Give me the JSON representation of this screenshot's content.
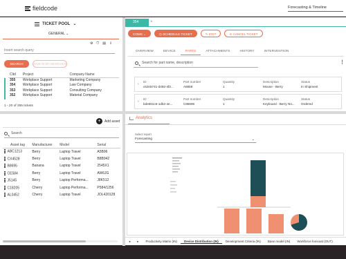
{
  "app": {
    "brand": "fieldcode",
    "view_selector": "Forecasting & Timeline"
  },
  "ticket_pool": {
    "title": "TICKET POOL",
    "subtitle": "GENERAL",
    "search_placeholder": "Insert search query",
    "search_btn": "SEARCH",
    "save_btn": "SAVE IN MY SEARCHES",
    "columns": [
      "Cltd",
      "Project",
      "Company Name"
    ],
    "rows": [
      [
        "355",
        "Workplace Support",
        "Marketing Company"
      ],
      [
        "354",
        "Workplace Support",
        "Law Company"
      ],
      [
        "353",
        "Workplace Support",
        "Consulting Company"
      ],
      [
        "352",
        "Workplace Support",
        "Material Company"
      ]
    ],
    "count": "1 - 20 of 355 tickets"
  },
  "assets": {
    "add_label": "Add asset",
    "search_placeholder": "Search",
    "columns": [
      "Asset tag",
      "Manufacturer",
      "Model",
      "Serial"
    ],
    "rows": [
      [
        "ABC1213",
        "Berry",
        "Laptop Travel",
        "A5B96"
      ],
      [
        "CX4528",
        "Berry",
        "Laptop Travel",
        "B8B942"
      ],
      [
        "B8695",
        "Banana",
        "Laptop Travel",
        "2545X1"
      ],
      [
        "CE584",
        "Berry",
        "Laptop Travel",
        "AW6JG"
      ],
      [
        "J5145",
        "Berry",
        "Laptop Performa...",
        "J8K512"
      ],
      [
        "C18205",
        "Cherry",
        "Laptop Performa...",
        "P584/1256"
      ],
      [
        "AL0452",
        "Cherry",
        "Laptop Travel",
        "JOL420128"
      ]
    ]
  },
  "ticket": {
    "id_tab": "354",
    "actions": [
      "COMS",
      "SCHEDULE TICKET",
      "EDIT",
      "CANCEL TICKET"
    ],
    "tabs": [
      "OVERVIEW",
      "DEVICE",
      "PARTS",
      "ATTACHMENTS",
      "HISTORY",
      "INTERVENTION"
    ],
    "active_tab": "PARTS",
    "parts_search_placeholder": "Search for part name, description",
    "parts_labels": [
      "ID",
      "Part number",
      "Quantity",
      "Description",
      "Status"
    ],
    "parts": [
      {
        "id": "c62e5741-d492-4f3...",
        "part_number": "A8659",
        "quantity": "1",
        "description": "Mouse - Berry",
        "status": "In Shipment"
      },
      {
        "id": "bde661c6-1db2-4e...",
        "part_number": "C86696",
        "quantity": "1",
        "description": "Keyboard - Berry No...",
        "status": "Ordered"
      }
    ]
  },
  "analytics": {
    "tab": "Analytics",
    "report_label": "Select report",
    "report_value": "Forecasting",
    "bottom_tabs": [
      "Productivity Matrix (IN)",
      "Device Distribution (IN)",
      "Development Criteria (IN)",
      "Base model (IN)",
      "Workforce forecast (OUT)"
    ],
    "active_bottom_tab": "Device Distribution (IN)",
    "colors": {
      "teal": "#1f4f56",
      "orange": "#ef9070"
    }
  },
  "colors": {
    "accent": "#e86f4d",
    "teal": "#3bb8a6",
    "dark": "#2a2326"
  }
}
